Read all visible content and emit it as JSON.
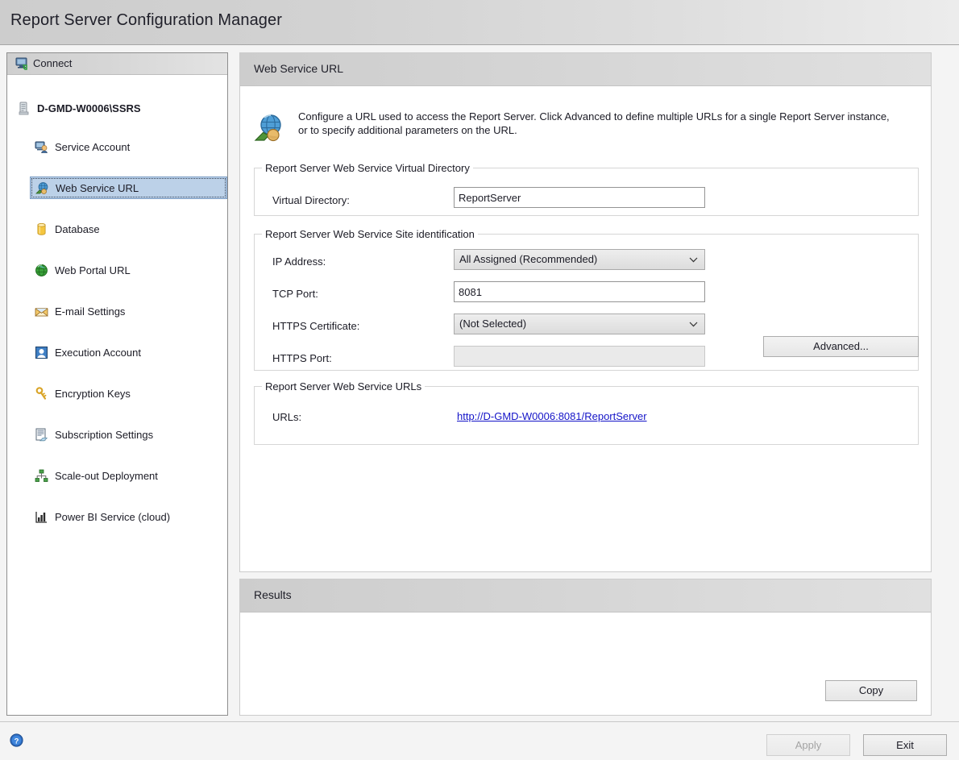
{
  "window": {
    "title": "Report Server Configuration Manager"
  },
  "sidebar": {
    "header_label": "Connect",
    "header_icon": "connect-computer-icon",
    "root": {
      "label": "D-GMD-W0006\\SSRS",
      "icon": "server-icon"
    },
    "items": [
      {
        "label": "Service Account",
        "icon": "service-account-icon",
        "selected": false
      },
      {
        "label": "Web Service URL",
        "icon": "web-service-url-icon",
        "selected": true
      },
      {
        "label": "Database",
        "icon": "database-icon",
        "selected": false
      },
      {
        "label": "Web Portal URL",
        "icon": "globe-icon",
        "selected": false
      },
      {
        "label": "E-mail Settings",
        "icon": "email-icon",
        "selected": false
      },
      {
        "label": "Execution Account",
        "icon": "execution-account-icon",
        "selected": false
      },
      {
        "label": "Encryption Keys",
        "icon": "key-icon",
        "selected": false
      },
      {
        "label": "Subscription Settings",
        "icon": "subscription-icon",
        "selected": false
      },
      {
        "label": "Scale-out Deployment",
        "icon": "scale-out-icon",
        "selected": false
      },
      {
        "label": "Power BI Service (cloud)",
        "icon": "power-bi-icon",
        "selected": false
      }
    ]
  },
  "main": {
    "header_title": "Web Service URL",
    "description": "Configure a URL used to access the Report Server.  Click Advanced to define multiple URLs for a single Report Server instance, or to specify additional parameters on the URL.",
    "description_icon": "web-service-globe-icon",
    "virtual_directory_group": {
      "title": "Report Server Web Service Virtual Directory",
      "label": "Virtual Directory:",
      "value": "ReportServer"
    },
    "site_identification_group": {
      "title": "Report Server Web Service Site identification",
      "ip_address_label": "IP Address:",
      "ip_address_value": "All Assigned (Recommended)",
      "tcp_port_label": "TCP Port:",
      "tcp_port_value": "8081",
      "https_certificate_label": "HTTPS Certificate:",
      "https_certificate_value": "(Not Selected)",
      "https_port_label": "HTTPS Port:",
      "https_port_value": "",
      "advanced_button": "Advanced..."
    },
    "urls_group": {
      "title": "Report Server Web Service URLs",
      "label": "URLs:",
      "url": "http://D-GMD-W0006:8081/ReportServer"
    }
  },
  "results": {
    "header_title": "Results",
    "body_text": "",
    "copy_button": "Copy"
  },
  "footer": {
    "help_icon": "help-icon",
    "apply_button": "Apply",
    "exit_button": "Exit"
  },
  "colors": {
    "selection_fill": "#bcd1e8",
    "selection_border": "#7a9cc4",
    "link": "#1414c8",
    "titlebar_start": "#cdcdcd",
    "titlebar_end": "#ececec"
  }
}
